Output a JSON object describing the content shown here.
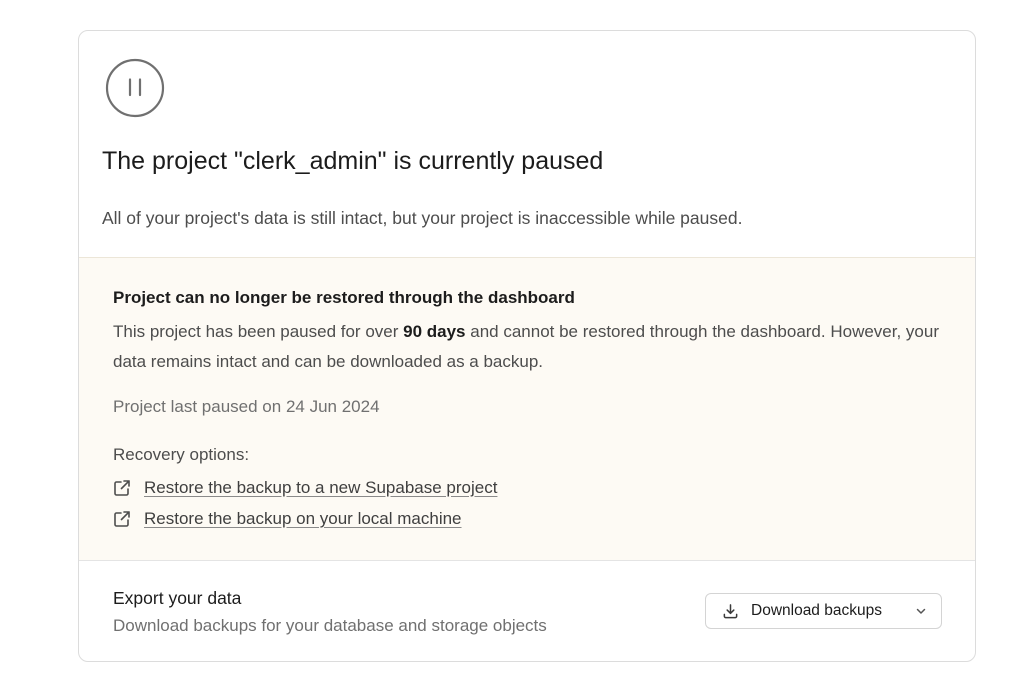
{
  "header": {
    "icon": "pause-circle-icon",
    "title": "The project \"clerk_admin\" is currently paused",
    "subtitle": "All of your project's data is still intact, but your project is inaccessible while paused."
  },
  "warning": {
    "title": "Project can no longer be restored through the dashboard",
    "body_before": "This project has been paused for over ",
    "body_emphasis": "90 days",
    "body_after": " and cannot be restored through the dashboard. However, your data remains intact and can be downloaded as a backup.",
    "paused_on": "Project last paused on 24 Jun 2024",
    "recovery_label": "Recovery options:",
    "links": [
      {
        "label": "Restore the backup to a new Supabase project",
        "icon": "external-link-icon"
      },
      {
        "label": "Restore the backup on your local machine",
        "icon": "external-link-icon"
      }
    ]
  },
  "export": {
    "title": "Export your data",
    "description": "Download backups for your database and storage objects",
    "button_label": "Download backups",
    "button_icon": "download-icon"
  },
  "colors": {
    "warning_bg": "#fdfaf4",
    "border": "#dcdcdc",
    "text_primary": "#1c1c1c",
    "text_muted": "#707070"
  }
}
